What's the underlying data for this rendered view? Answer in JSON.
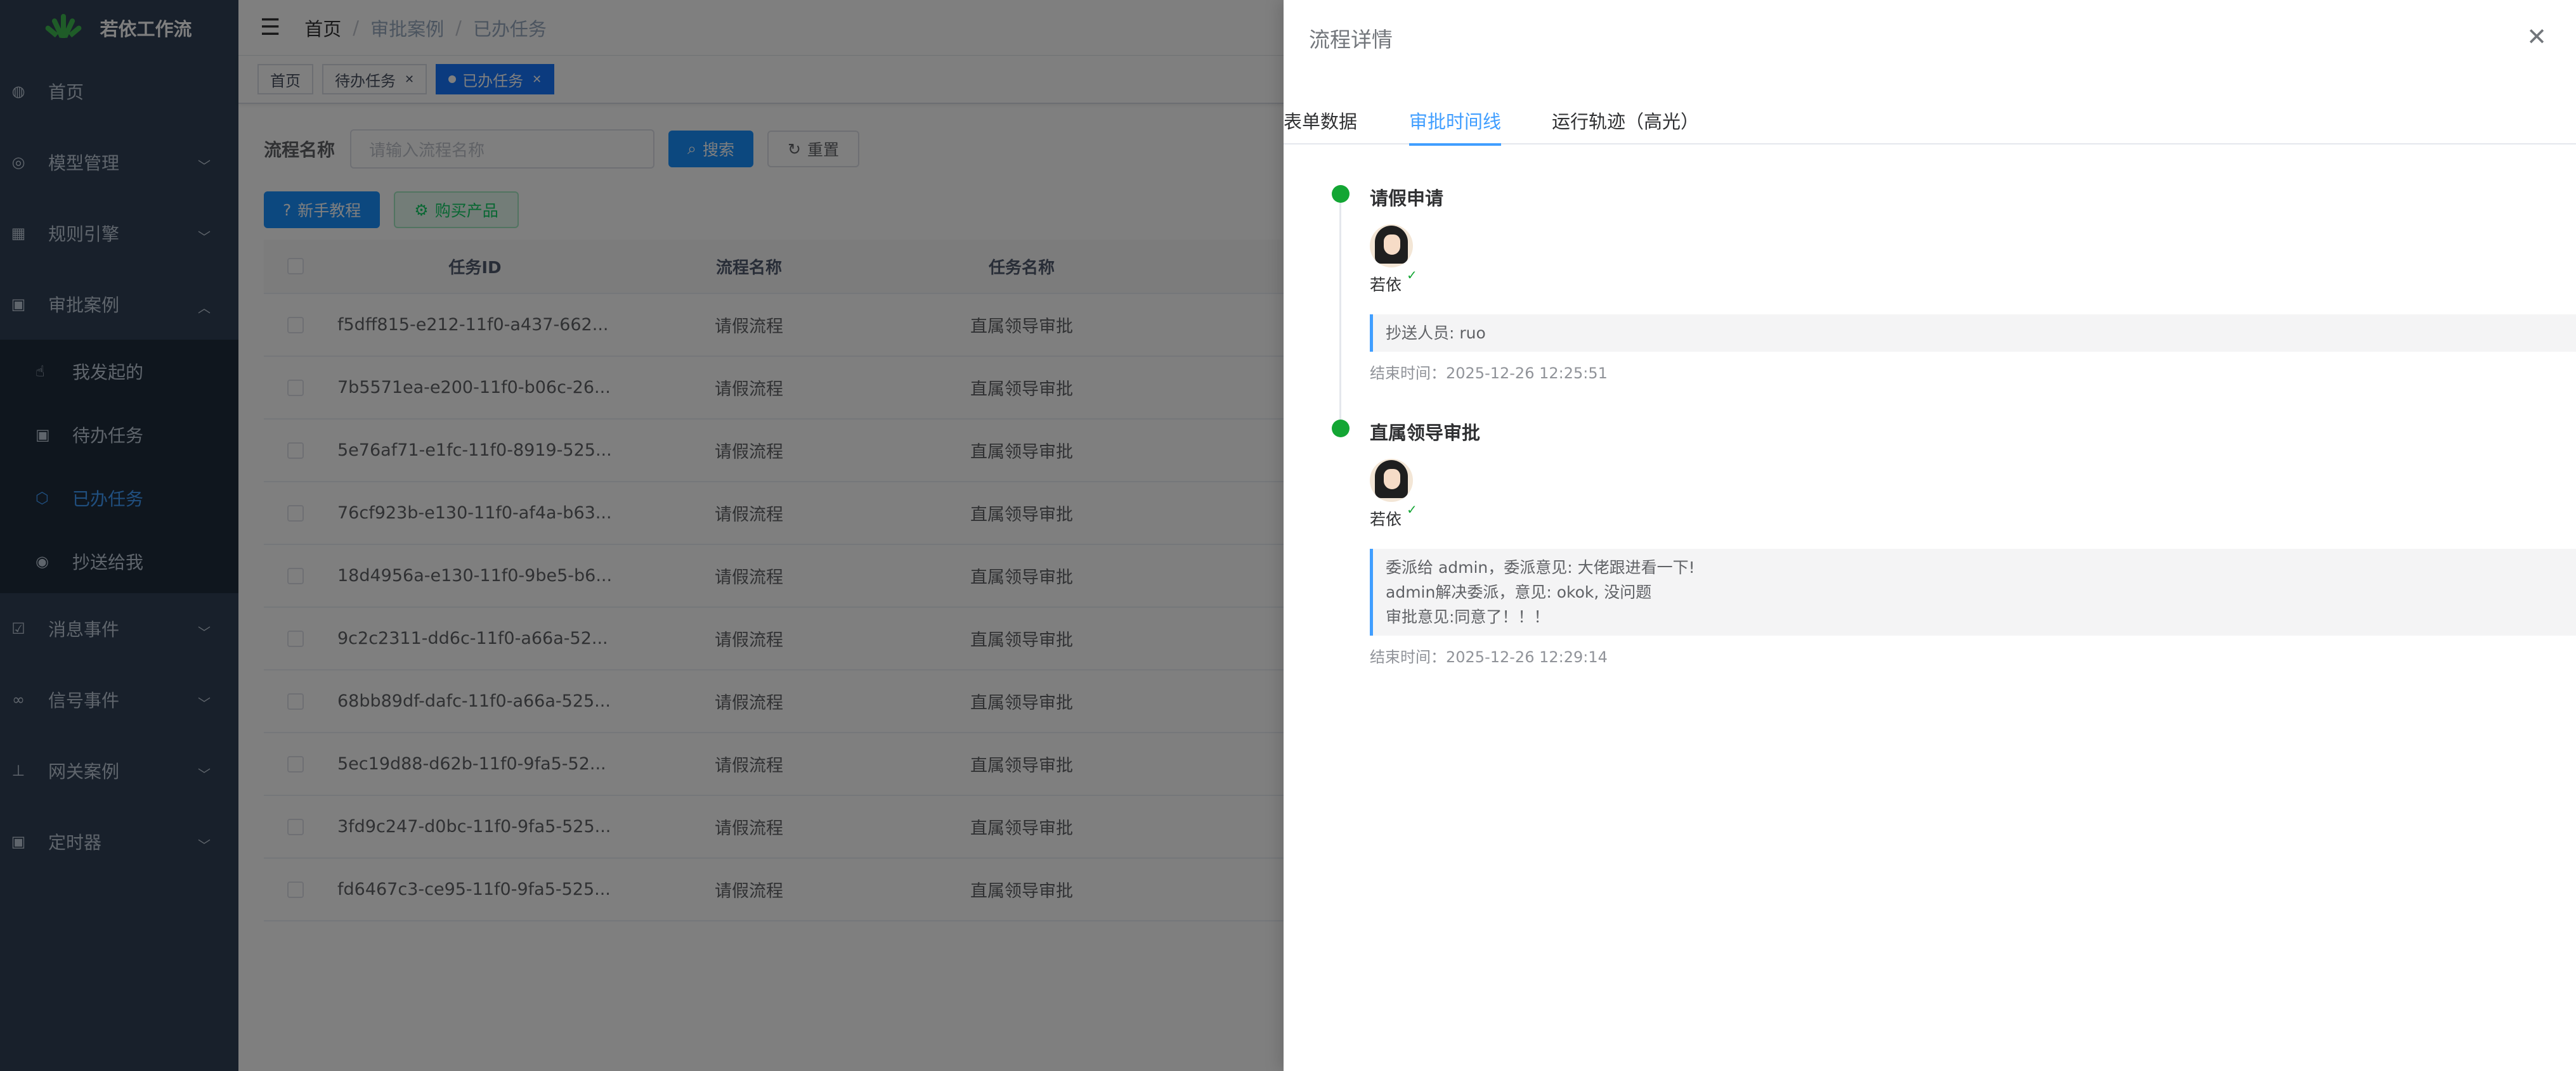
{
  "sidebar": {
    "app_title": "若依工作流",
    "menu": [
      {
        "label": "首页",
        "icon": "dashboard-icon"
      },
      {
        "label": "模型管理",
        "icon": "model-icon"
      },
      {
        "label": "规则引擎",
        "icon": "grid-icon"
      },
      {
        "label": "审批案例",
        "icon": "doc-icon"
      },
      {
        "label": "消息事件",
        "icon": "checkbox-icon"
      },
      {
        "label": "信号事件",
        "icon": "link-icon"
      },
      {
        "label": "网关案例",
        "icon": "tree-icon"
      },
      {
        "label": "定时器",
        "icon": "timer-icon"
      }
    ],
    "submenu": [
      {
        "label": "我发起的",
        "icon": "hand-icon"
      },
      {
        "label": "待办任务",
        "icon": "doc-icon"
      },
      {
        "label": "已办任务",
        "icon": "finished-icon"
      },
      {
        "label": "抄送给我",
        "icon": "check-circle-icon"
      }
    ]
  },
  "navbar": {
    "breadcrumb": [
      "首页",
      "审批案例",
      "已办任务"
    ]
  },
  "tags": [
    {
      "label": "首页"
    },
    {
      "label": "待办任务"
    },
    {
      "label": "已办任务"
    }
  ],
  "search": {
    "label": "流程名称",
    "placeholder": "请输入流程名称",
    "search_label": "搜索",
    "reset_label": "重置"
  },
  "toolbar": {
    "guide_label": "新手教程",
    "buy_label": "购买产品"
  },
  "table": {
    "headers": [
      "任务ID",
      "流程名称",
      "任务名称"
    ],
    "rows": [
      [
        "f5dff815-e212-11f0-a437-662...",
        "请假流程",
        "直属领导审批"
      ],
      [
        "7b5571ea-e200-11f0-b06c-26...",
        "请假流程",
        "直属领导审批"
      ],
      [
        "5e76af71-e1fc-11f0-8919-525...",
        "请假流程",
        "直属领导审批"
      ],
      [
        "76cf923b-e130-11f0-af4a-b63...",
        "请假流程",
        "直属领导审批"
      ],
      [
        "18d4956a-e130-11f0-9be5-b6...",
        "请假流程",
        "直属领导审批"
      ],
      [
        "9c2c2311-dd6c-11f0-a66a-52...",
        "请假流程",
        "直属领导审批"
      ],
      [
        "68bb89df-dafc-11f0-a66a-525...",
        "请假流程",
        "直属领导审批"
      ],
      [
        "5ec19d88-d62b-11f0-9fa5-52...",
        "请假流程",
        "直属领导审批"
      ],
      [
        "3fd9c247-d0bc-11f0-9fa5-525...",
        "请假流程",
        "直属领导审批"
      ],
      [
        "fd6467c3-ce95-11f0-9fa5-525...",
        "请假流程",
        "直属领导审批"
      ]
    ]
  },
  "drawer": {
    "title": "流程详情",
    "tabs": [
      "表单数据",
      "审批时间线",
      "运行轨迹（高光）"
    ],
    "timeline": [
      {
        "title": "请假申请",
        "user": "若依",
        "notes": [
          "抄送人员: ruo"
        ],
        "end_time": "结束时间：2025-12-26 12:25:51"
      },
      {
        "title": "直属领导审批",
        "user": "若依",
        "notes": [
          "委派给 admin，委派意见: 大佬跟进看一下!",
          "admin解决委派，意见: okok, 没问题",
          "审批意见:同意了！！！"
        ],
        "end_time": "结束时间：2025-12-26 12:29:14"
      }
    ]
  },
  "colors": {
    "sidebar_bg": "#304156",
    "submenu_bg": "#1f2d3d",
    "primary": "#1890ff",
    "success": "#13a634",
    "active_tab": "#409eff"
  }
}
